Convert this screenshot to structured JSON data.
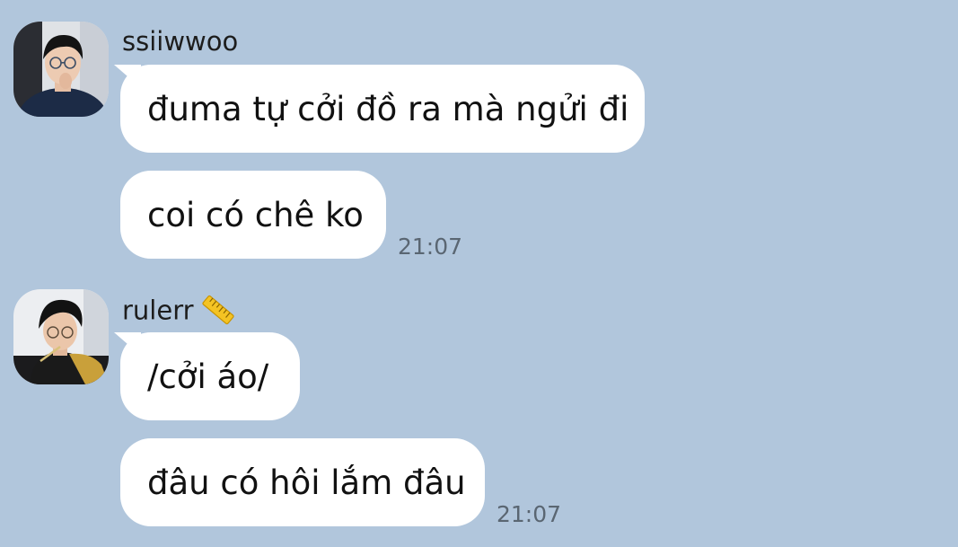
{
  "colors": {
    "background": "#b1c6dc",
    "bubble": "#ffffff",
    "timestamp": "#5a6672"
  },
  "messages": [
    {
      "sender": "ssiiwwoo",
      "avatar_icon": "user-avatar-photo",
      "lines": [
        "đuma tự cởi đồ ra mà ngửi đi",
        "coi có chê ko"
      ],
      "time": "21:07"
    },
    {
      "sender": "rulerr",
      "sender_emoji": "📏",
      "avatar_icon": "user-avatar-photo",
      "lines": [
        "/cởi áo/",
        "đâu có hôi lắm đâu"
      ],
      "time": "21:07"
    }
  ]
}
